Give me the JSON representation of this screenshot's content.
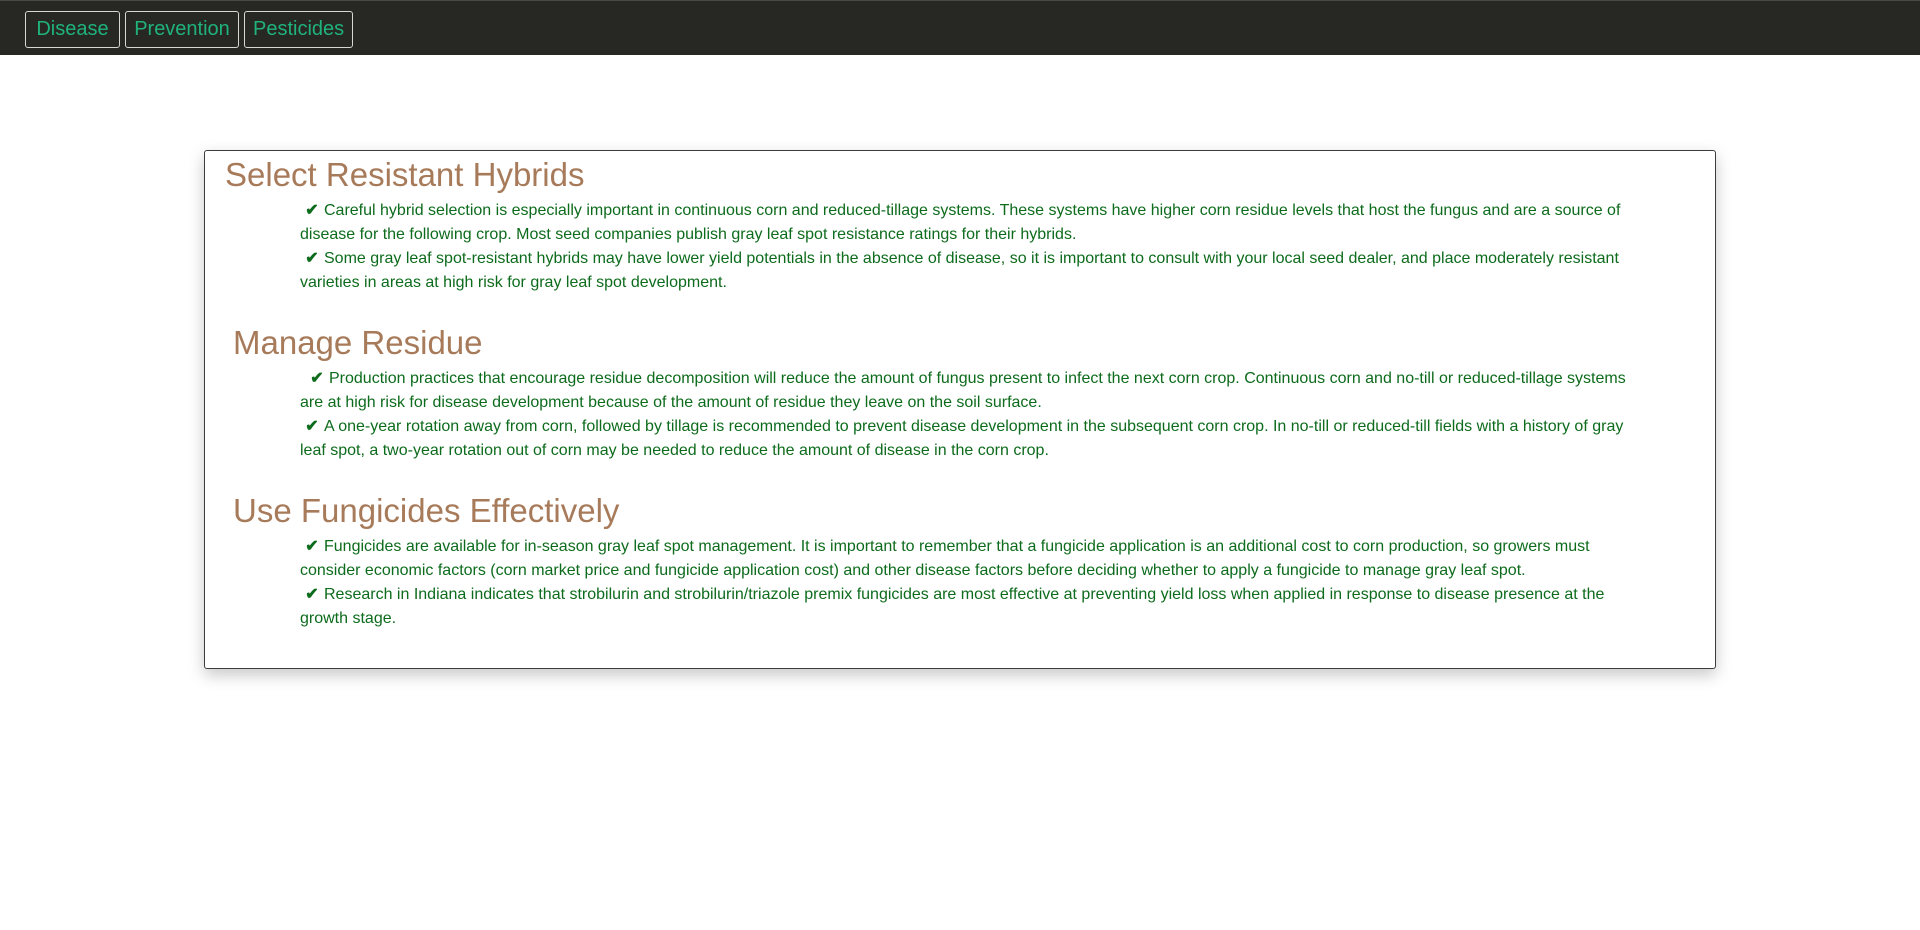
{
  "nav": {
    "buttons": [
      {
        "label": "Disease"
      },
      {
        "label": "Prevention"
      },
      {
        "label": "Pesticides"
      }
    ],
    "text_color": "#1fb37a",
    "bar_color": "#272723"
  },
  "sections": [
    {
      "title": "Select Resistant Hybrids",
      "bullets": [
        {
          "icon": "check-icon",
          "text": "Careful hybrid selection is especially important in continuous corn and reduced-tillage systems. These   systems have higher corn residue levels that host the fungus and are a source of disease for the following crop.   Most seed companies publish gray leaf spot resistance ratings for their hybrids."
        },
        {
          "icon": "check-icon",
          "text": "Some gray leaf spot-resistant hybrids may have lower yield potentials in the absence of disease, so it is   important to consult with your local seed dealer, and place moderately resistant varieties in areas at high risk for   gray leaf spot development."
        }
      ]
    },
    {
      "title": "Manage Residue",
      "bullets": [
        {
          "icon": "check-icon",
          "text": "Production practices that encourage residue decomposition will reduce the amount of fungus present to   infect  the next corn crop. Continuous corn and no-till or reduced-tillage systems are at high risk for disease   development because of the amount of residue they leave on the soil surface."
        },
        {
          "icon": "check-icon",
          "text": "A one-year rotation away from corn, followed by tillage is recommended to prevent disease development in   the subsequent corn crop. In no-till or reduced-till fields with a history of gray leaf spot, a two-year rotation out of   corn may be needed to reduce the amount of disease in the corn crop."
        }
      ]
    },
    {
      "title": "Use Fungicides Effectively",
      "bullets": [
        {
          "icon": "check-icon",
          "text": "Fungicides are available for in-season gray leaf spot management. It is important to remember that a   fungicide application is an additional cost to corn production, so growers must consider economic factors (corn   market price and fungicide application cost) and other disease factors before deciding whether to apply a   fungicide to manage gray leaf spot."
        },
        {
          "icon": "check-icon",
          "text": "Research in Indiana indicates that strobilurin and strobilurin/triazole premix fungicides are most effective at   preventing yield loss when applied in response to disease presence at the growth stage."
        }
      ]
    }
  ],
  "colors": {
    "title": "#a77a5a",
    "body_text": "#0d6b1c"
  }
}
